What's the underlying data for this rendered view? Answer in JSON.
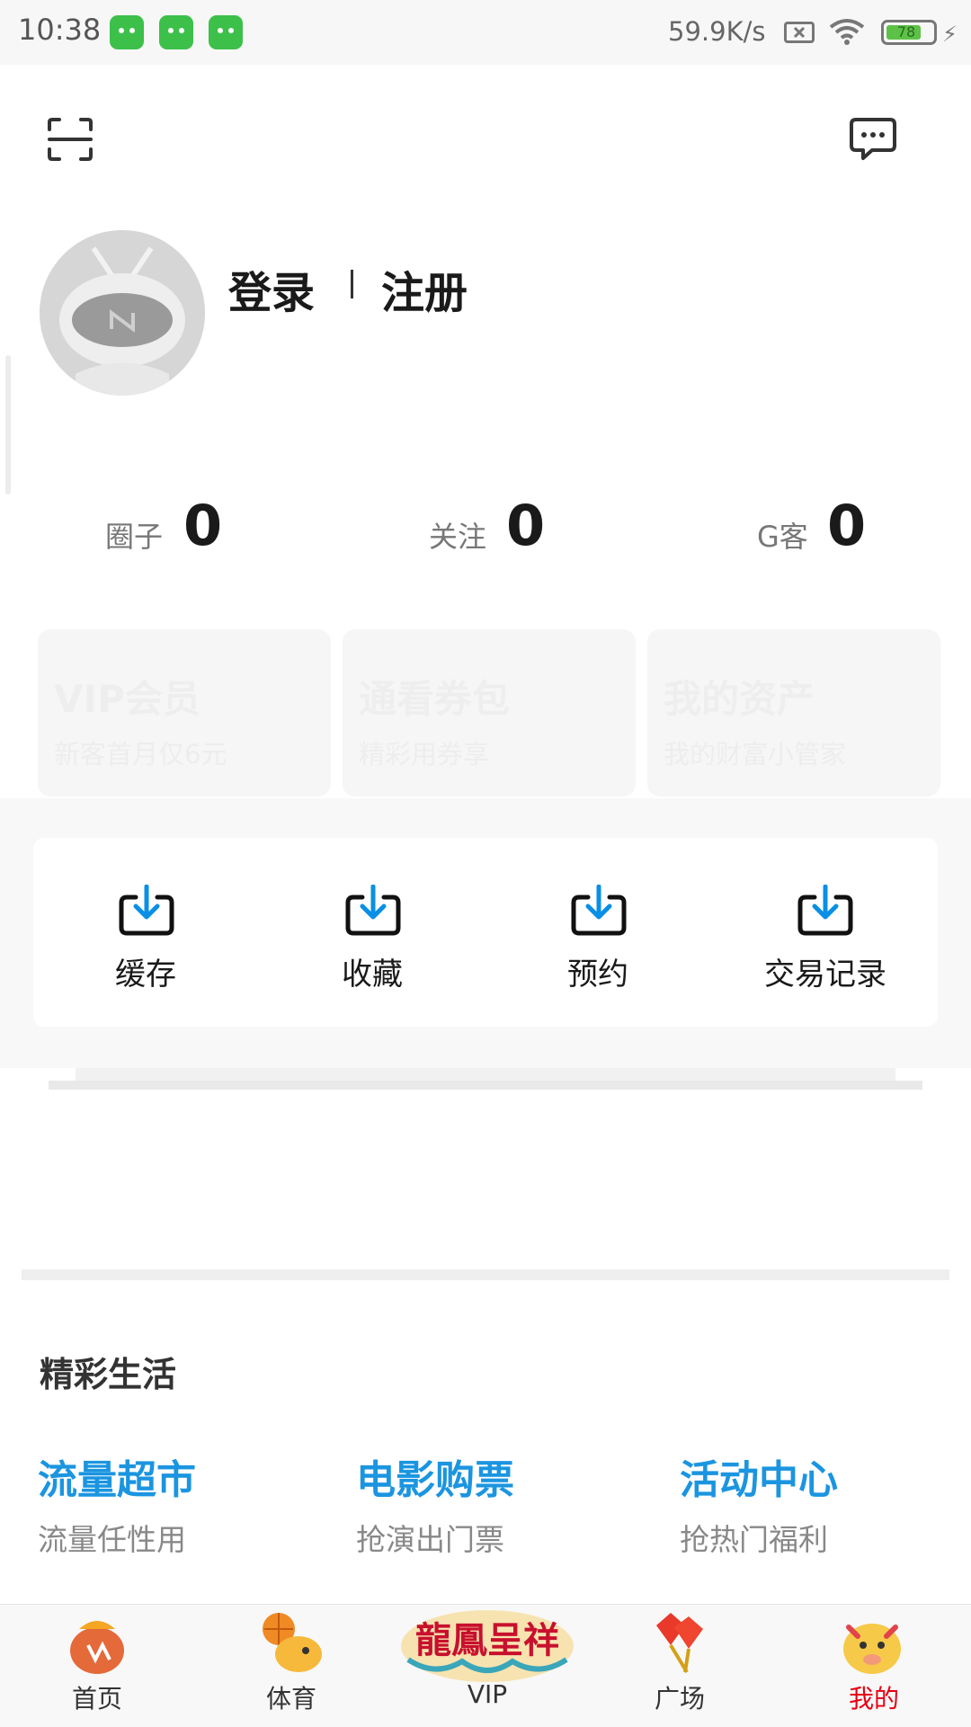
{
  "status_bar": {
    "time": "10:38",
    "net_speed": "59.9K/s",
    "battery": "78"
  },
  "header": {
    "login": "登录",
    "register": "注册"
  },
  "stats": [
    {
      "label": "圈子",
      "value": "0"
    },
    {
      "label": "关注",
      "value": "0"
    },
    {
      "label": "G客",
      "value": "0"
    }
  ],
  "promos": [
    {
      "title": "VIP会员",
      "subtitle": "新客首月仅6元"
    },
    {
      "title": "通看券包",
      "subtitle": "精彩用券享"
    },
    {
      "title": "我的资产",
      "subtitle": "我的财富小管家"
    }
  ],
  "tools": [
    {
      "label": "缓存",
      "icon": "download-icon"
    },
    {
      "label": "收藏",
      "icon": "download-icon"
    },
    {
      "label": "预约",
      "icon": "download-icon"
    },
    {
      "label": "交易记录",
      "icon": "download-icon"
    }
  ],
  "life": {
    "title": "精彩生活",
    "items": [
      {
        "title": "流量超市",
        "subtitle": "流量任性用"
      },
      {
        "title": "电影购票",
        "subtitle": "抢演出门票"
      },
      {
        "title": "活动中心",
        "subtitle": "抢热门福利"
      }
    ]
  },
  "nav": [
    {
      "label": "首页"
    },
    {
      "label": "体育"
    },
    {
      "label": "VIP",
      "logo_text": "龍鳳呈祥"
    },
    {
      "label": "广场"
    },
    {
      "label": "我的"
    }
  ],
  "colors": {
    "accent_blue": "#1b95e0",
    "active_tab": "#e60012",
    "icon_blue": "#0a8fe6"
  }
}
